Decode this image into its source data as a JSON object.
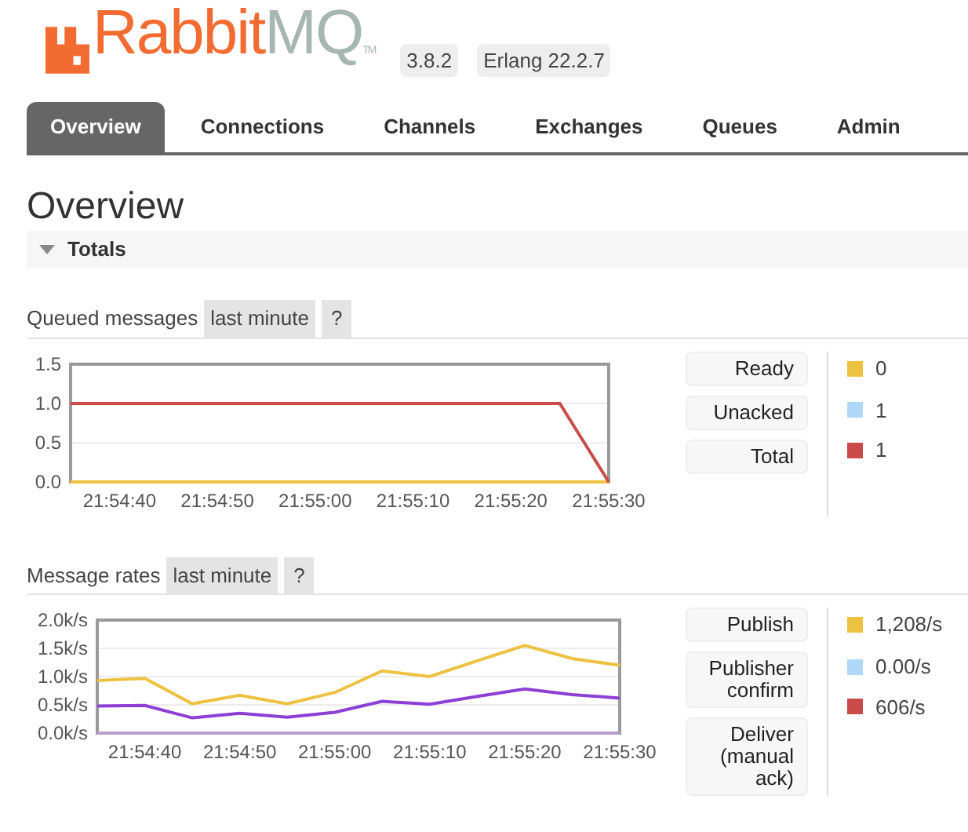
{
  "header": {
    "logo": {
      "brand": "Rabbit",
      "suffix": "MQ",
      "mark": "TM"
    },
    "version": "3.8.2",
    "erlang": "Erlang 22.2.7"
  },
  "tabs": [
    {
      "label": "Overview",
      "selected": true
    },
    {
      "label": "Connections",
      "selected": false
    },
    {
      "label": "Channels",
      "selected": false
    },
    {
      "label": "Exchanges",
      "selected": false
    },
    {
      "label": "Queues",
      "selected": false
    },
    {
      "label": "Admin",
      "selected": false
    }
  ],
  "title": "Overview",
  "totals": {
    "label": "Totals",
    "expanded": true
  },
  "sections": [
    {
      "title": "Queued messages",
      "range": "last minute",
      "help": "?",
      "chart_data": {
        "type": "line",
        "categories": [
          null,
          "21:54:40",
          null,
          "21:54:50",
          null,
          "21:55:00",
          null,
          "21:55:10",
          null,
          "21:55:20",
          null,
          "21:55:30"
        ],
        "ylim": [
          0,
          1.5
        ],
        "grid": true,
        "yticks": [
          {
            "value": 0,
            "label": "0.0"
          },
          {
            "value": 0.5,
            "label": "0.5"
          },
          {
            "value": 1,
            "label": "1.0"
          },
          {
            "value": 1.5,
            "label": "1.5"
          }
        ],
        "series": [
          {
            "color": "#edc240",
            "values": [
              0,
              0,
              0,
              0,
              0,
              0,
              0,
              0,
              0,
              0,
              0,
              0
            ]
          },
          {
            "color": "#cb4b4b",
            "values": [
              1,
              1,
              1,
              1,
              1,
              1,
              1,
              1,
              1,
              1,
              1,
              0
            ]
          }
        ]
      },
      "legend": [
        {
          "label": "Ready",
          "color": "#edc240",
          "value": "0"
        },
        {
          "label": "Unacked",
          "color": "#afd8f8",
          "value": "1"
        },
        {
          "label": "Total",
          "color": "#cb4b4b",
          "value": "1"
        }
      ]
    },
    {
      "title": "Message rates",
      "range": "last minute",
      "help": "?",
      "chart_data": {
        "type": "line",
        "categories": [
          null,
          "21:54:40",
          null,
          "21:54:50",
          null,
          "21:55:00",
          null,
          "21:55:10",
          null,
          "21:55:20",
          null,
          "21:55:30"
        ],
        "ylim": [
          0,
          2000
        ],
        "grid": true,
        "yticks": [
          {
            "value": 0,
            "label": "0.0k/s"
          },
          {
            "value": 500,
            "label": "0.5k/s"
          },
          {
            "value": 1000,
            "label": "1.0k/s"
          },
          {
            "value": 1500,
            "label": "1.5k/s"
          },
          {
            "value": 2000,
            "label": "2.0k/s"
          }
        ],
        "series": [
          {
            "color": "#edc240",
            "values": [
              930,
              970,
              520,
              670,
              520,
              720,
              1100,
              1000,
              1280,
              1550,
              1320,
              1200
            ]
          },
          {
            "color": "#b89cc8",
            "values": [
              0,
              0,
              0,
              0,
              0,
              0,
              0,
              0,
              0,
              0,
              0,
              0
            ]
          },
          {
            "color": "#8c3fd4",
            "values": [
              480,
              490,
              270,
              350,
              280,
              370,
              560,
              510,
              650,
              780,
              680,
              620
            ]
          }
        ]
      },
      "legend": [
        {
          "label": "Publish",
          "color": "#edc240",
          "value": "1,208/s"
        },
        {
          "label": "Publisher confirm",
          "color": "#afd8f8",
          "value": "0.00/s"
        },
        {
          "label": "Deliver (manual ack)",
          "color": "#cb4b4b",
          "value": "606/s"
        }
      ]
    }
  ]
}
